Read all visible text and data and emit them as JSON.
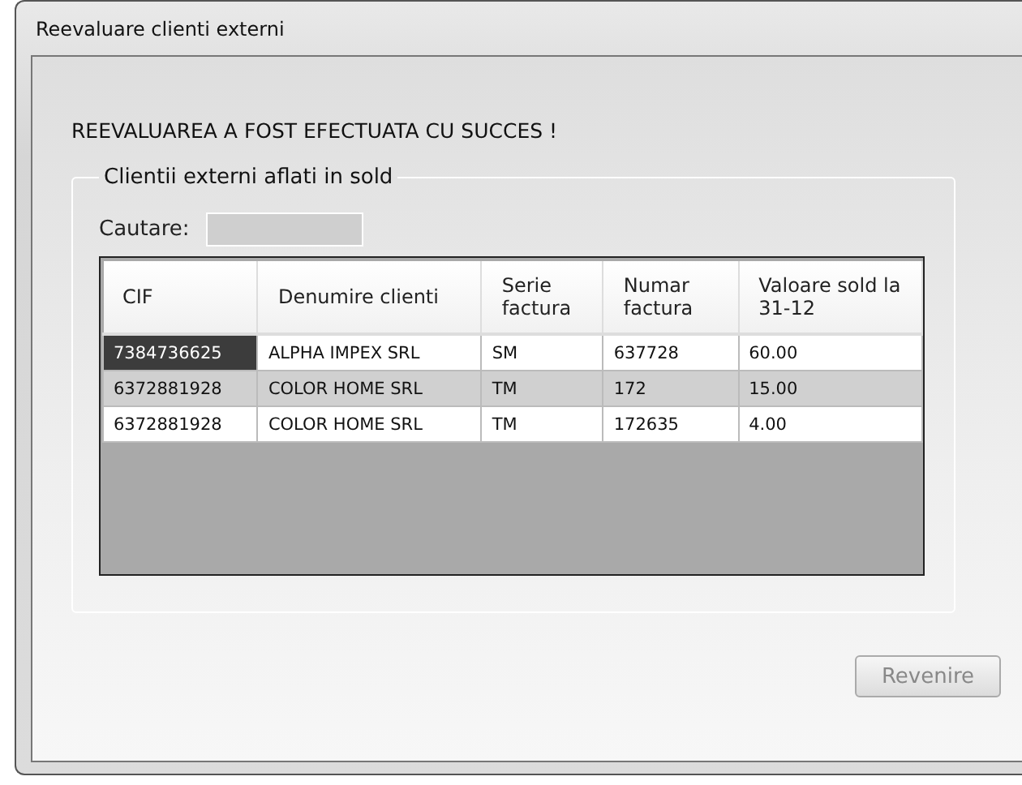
{
  "window": {
    "title": "Reevaluare clienti externi"
  },
  "message": "REEVALUAREA A FOST EFECTUATA CU SUCCES !",
  "group": {
    "title": "Clientii externi aflati in sold"
  },
  "search": {
    "label": "Cautare:"
  },
  "table": {
    "columns": [
      "CIF",
      "Denumire clienti",
      "Serie factura",
      "Numar factura",
      "Valoare sold la 31-12"
    ],
    "rows": [
      {
        "cells": [
          "7384736625",
          "ALPHA IMPEX SRL",
          "SM",
          "637728",
          "60.00"
        ],
        "selected": false,
        "current": true
      },
      {
        "cells": [
          "6372881928",
          "COLOR HOME SRL",
          "TM",
          "172",
          "15.00"
        ],
        "selected": true,
        "current": false
      },
      {
        "cells": [
          "6372881928",
          "COLOR HOME SRL",
          "TM",
          "172635",
          "4.00"
        ],
        "selected": false,
        "current": false
      }
    ]
  },
  "buttons": [
    {
      "label": "Revenire",
      "disabled": true
    }
  ]
}
